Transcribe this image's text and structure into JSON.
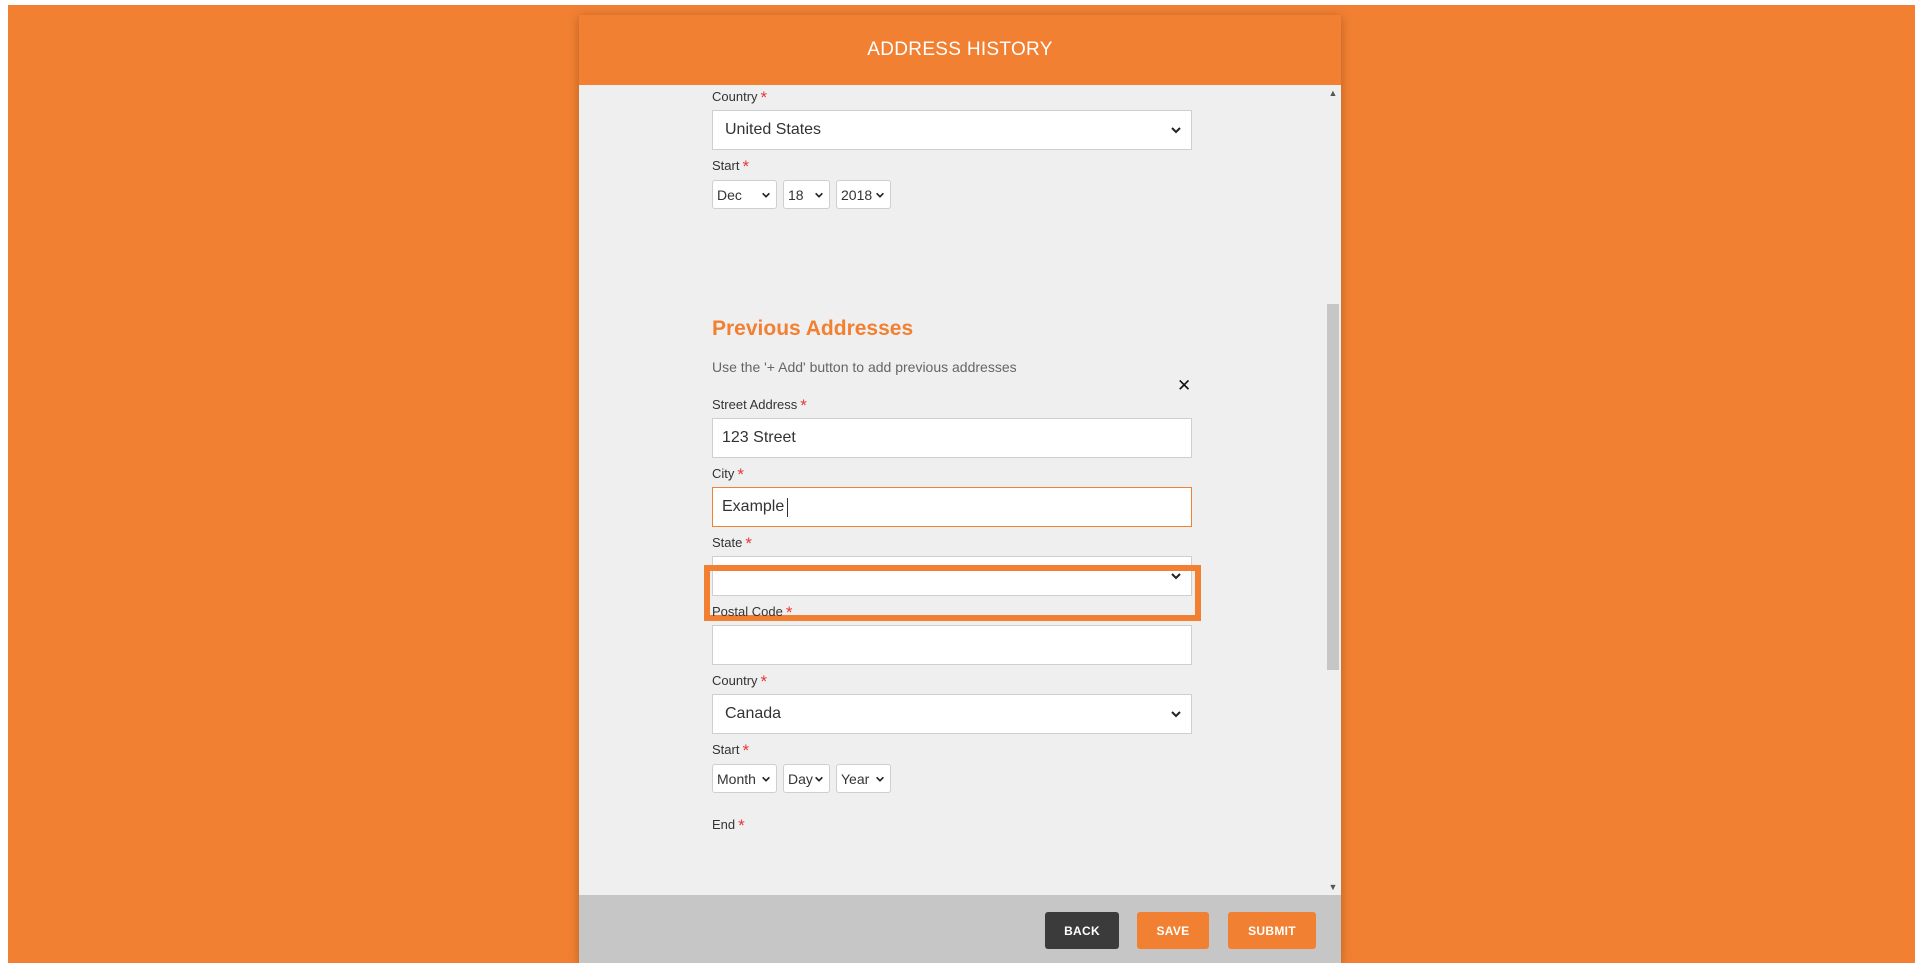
{
  "modal": {
    "title": "ADDRESS HISTORY"
  },
  "current_address": {
    "country_label": "Country",
    "country_value": "United States",
    "start_label": "Start",
    "start_month": "Dec",
    "start_day": "18",
    "start_year": "2018"
  },
  "previous": {
    "section_title": "Previous Addresses",
    "helper_text": "Use the '+ Add' button to add previous addresses",
    "street_label": "Street Address",
    "street_value": "123 Street",
    "city_label": "City",
    "city_value": "Example",
    "state_label": "State",
    "state_value": "",
    "postal_label": "Postal Code",
    "postal_value": "",
    "country_label": "Country",
    "country_value": "Canada",
    "start_label": "Start",
    "start_month": "Month",
    "start_day": "Day",
    "start_year": "Year",
    "end_label": "End"
  },
  "required_mark": "*",
  "footer": {
    "back_label": "BACK",
    "save_label": "SAVE",
    "submit_label": "SUBMIT"
  },
  "colors": {
    "accent": "#f28032",
    "required": "#e53935",
    "back_button": "#3b3b3b",
    "footer_bg": "#c6c6c6"
  },
  "icons": {
    "remove": "close-icon",
    "select": "chevron-down-icon"
  }
}
